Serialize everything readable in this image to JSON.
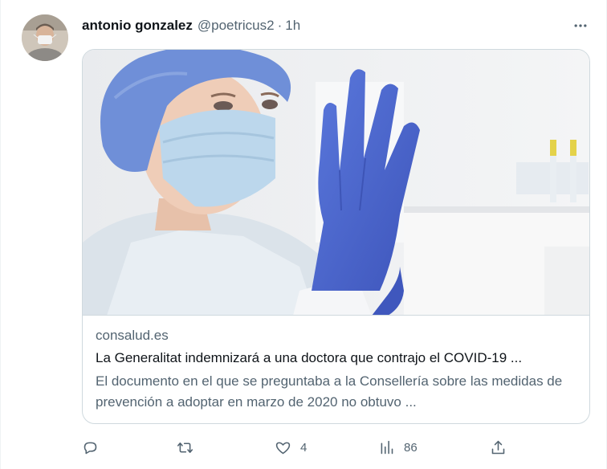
{
  "tweet": {
    "author_name": "antonio gonzalez",
    "handle": "@poetricus2",
    "separator": "·",
    "time": "1h",
    "avatar": "avatar-photo-masked-man",
    "more_icon": "more-horizontal-icon"
  },
  "card": {
    "image": "doctor-putting-on-blue-gloves-photo",
    "domain": "consalud.es",
    "title": "La Generalitat indemnizará a una doctora que contrajo el COVID-19 ...",
    "description": "El documento en el que se preguntaba a la Consellería sobre las medidas de prevención a adoptar en marzo de 2020 no obtuvo ..."
  },
  "actions": {
    "reply": {
      "icon": "reply-icon",
      "count": ""
    },
    "retweet": {
      "icon": "retweet-icon",
      "count": ""
    },
    "like": {
      "icon": "heart-icon",
      "count": "4"
    },
    "views": {
      "icon": "views-chart-icon",
      "count": "86"
    },
    "share": {
      "icon": "share-icon",
      "count": ""
    }
  },
  "colors": {
    "text_primary": "#0f1419",
    "text_secondary": "#536471",
    "border": "#cfd9de",
    "glove_blue": "#4a67d0",
    "cap_blue": "#6f8fd8",
    "mask_blue": "#b9d6ec"
  }
}
